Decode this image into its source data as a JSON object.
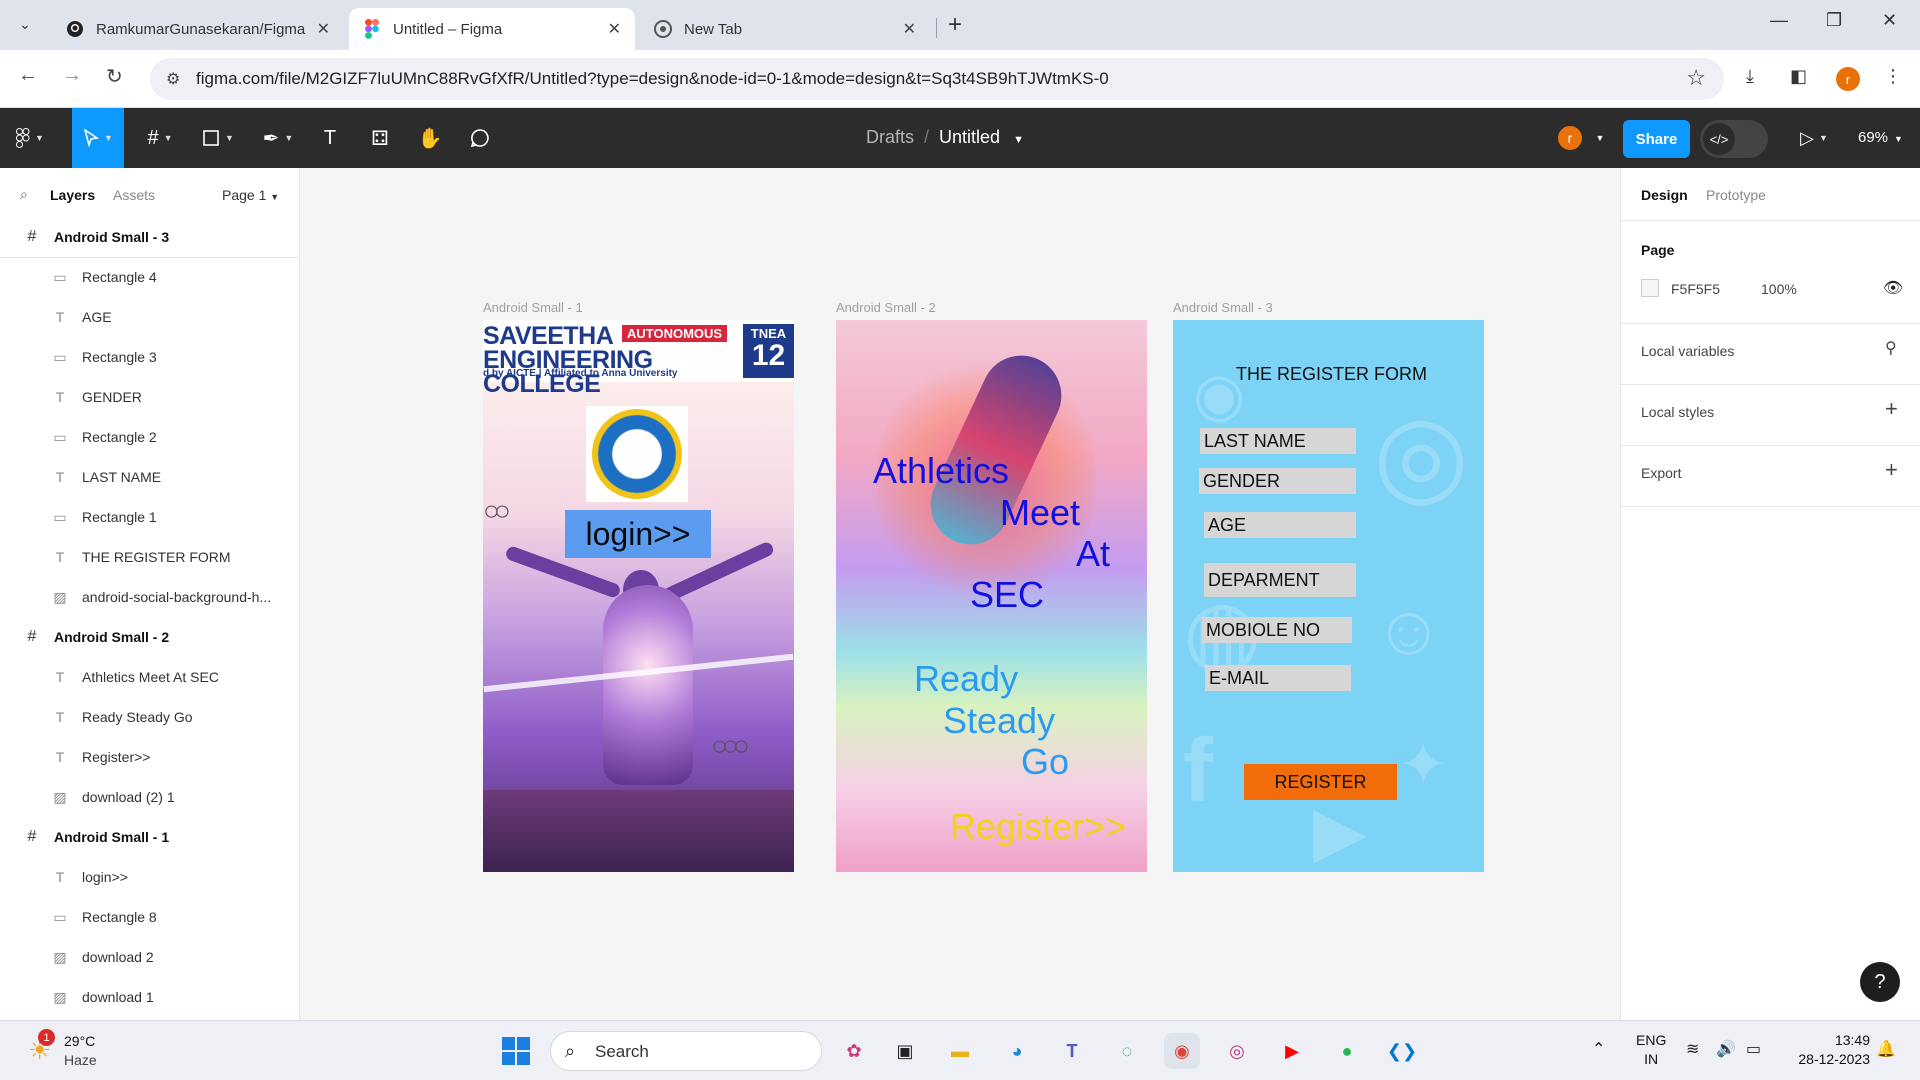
{
  "browser": {
    "tabs": [
      {
        "title": "RamkumarGunasekaran/Figma",
        "icon": "github-icon"
      },
      {
        "title": "Untitled – Figma",
        "icon": "figma-icon"
      },
      {
        "title": "New Tab",
        "icon": "chrome-icon"
      }
    ],
    "url": "figma.com/file/M2GIZF7luUMnC88RvGfXfR/Untitled?type=design&node-id=0-1&mode=design&t=Sq3t4SB9hTJWtmKS-0",
    "profile_initial": "r"
  },
  "figma_toolbar": {
    "breadcrumb_drafts": "Drafts",
    "breadcrumb_separator": "/",
    "file_name": "Untitled",
    "user_initial": "r",
    "share_label": "Share",
    "zoom": "69%"
  },
  "left_panel": {
    "tabs": [
      "Layers",
      "Assets"
    ],
    "page": "Page 1",
    "layers": [
      {
        "name": "Android Small - 3",
        "type": "frame"
      },
      {
        "name": "Rectangle 4",
        "type": "rect"
      },
      {
        "name": "AGE",
        "type": "text"
      },
      {
        "name": "Rectangle 3",
        "type": "rect"
      },
      {
        "name": "GENDER",
        "type": "text"
      },
      {
        "name": "Rectangle 2",
        "type": "rect"
      },
      {
        "name": "LAST NAME",
        "type": "text"
      },
      {
        "name": "Rectangle 1",
        "type": "rect"
      },
      {
        "name": "THE REGISTER FORM",
        "type": "text"
      },
      {
        "name": "android-social-background-h...",
        "type": "image"
      },
      {
        "name": "Android Small - 2",
        "type": "frame"
      },
      {
        "name": "Athletics Meet At SEC",
        "type": "text"
      },
      {
        "name": "Ready Steady Go",
        "type": "text"
      },
      {
        "name": "Register>>",
        "type": "text"
      },
      {
        "name": "download (2) 1",
        "type": "image"
      },
      {
        "name": "Android Small - 1",
        "type": "frame"
      },
      {
        "name": "login>>",
        "type": "text"
      },
      {
        "name": "Rectangle 8",
        "type": "rect"
      },
      {
        "name": "download 2",
        "type": "image"
      },
      {
        "name": "download 1",
        "type": "image"
      }
    ]
  },
  "canvas": {
    "frame_labels": [
      "Android Small - 1",
      "Android Small - 2",
      "Android Small - 3"
    ],
    "frame1": {
      "college_name_line1": "SAVEETHA",
      "college_name_line2": "ENGINEERING COLLEGE",
      "autonomous": "AUTONOMOUS",
      "college_sub": "d by AICTE  |  Affiliated to Anna University",
      "tnea": "TNEA",
      "tnea_code": "12",
      "login_label": "login>>"
    },
    "frame2": {
      "athletics": "Athletics",
      "meet": "Meet",
      "at": "At",
      "sec": "SEC",
      "ready": "Ready",
      "steady": "Steady",
      "go": "Go",
      "register": "Register>>"
    },
    "frame3": {
      "title": "THE REGISTER FORM",
      "fields": [
        "LAST NAME",
        "GENDER",
        "AGE",
        "DEPARMENT",
        "MOBIOLE NO",
        "E-MAIL"
      ],
      "register_button": "REGISTER"
    }
  },
  "right_panel": {
    "tabs": [
      "Design",
      "Prototype"
    ],
    "page_heading": "Page",
    "page_color": "F5F5F5",
    "page_opacity": "100%",
    "local_variables": "Local variables",
    "local_styles": "Local styles",
    "export": "Export",
    "help": "?"
  },
  "taskbar": {
    "weather_temp": "29°C",
    "weather_desc": "Haze",
    "weather_badge": "1",
    "search_placeholder": "Search",
    "lang_line1": "ENG",
    "lang_line2": "IN",
    "time": "13:49",
    "date": "28-12-2023"
  },
  "colors": {
    "figma_blue": "#0d99ff",
    "toolbar_bg": "#2c2c2c",
    "canvas_bg": "#f5f5f5",
    "register_orange": "#f26d0a",
    "login_blue": "#5b9bf0"
  }
}
